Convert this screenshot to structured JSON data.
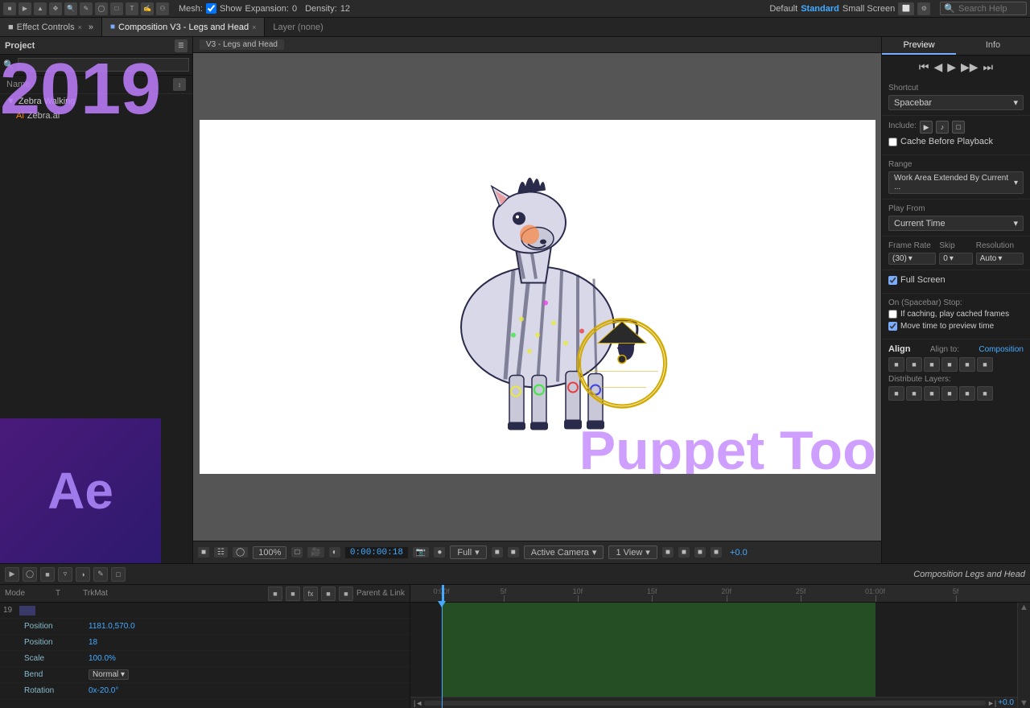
{
  "toolbar": {
    "mesh_label": "Mesh:",
    "show_label": "Show",
    "expansion_label": "Expansion:",
    "expansion_value": "0",
    "density_label": "Density:",
    "density_value": "12",
    "view_default": "Default",
    "view_standard": "Standard",
    "view_small": "Small Screen",
    "search_placeholder": "Search Help"
  },
  "tabs": {
    "effect_controls": "Effect Controls",
    "comp_tab": "Composition V3 - Legs and Head",
    "layer_none": "Layer (none)"
  },
  "breadcrumb": "V3 - Legs and Head",
  "project_panel": {
    "title": "Project",
    "search_placeholder": "",
    "items": [
      {
        "name": "Zebra Walking",
        "type": "folder"
      },
      {
        "name": "Zebra.ai",
        "type": "ai"
      }
    ]
  },
  "viewport": {
    "zoom": "100%",
    "timecode": "0:00:00:18",
    "quality": "Full",
    "camera": "Active Camera",
    "views": "1 View",
    "offset": "+0.0"
  },
  "right_panel": {
    "preview_tab": "Preview",
    "info_tab": "Info",
    "shortcut_label": "Shortcut",
    "shortcut_value": "Spacebar",
    "include_label": "Include:",
    "cache_label": "Cache Before Playback",
    "range_label": "Range",
    "range_value": "Work Area Extended By Current ...",
    "play_from_label": "Play From",
    "play_from_value": "Current Time",
    "frame_rate_label": "Frame Rate",
    "frame_rate_value": "(30)",
    "skip_label": "Skip",
    "skip_value": "0",
    "resolution_label": "Resolution",
    "resolution_value": "Auto",
    "full_screen_label": "Full Screen",
    "on_stop_label": "On (Spacebar) Stop:",
    "cached_frames_label": "If caching, play cached frames",
    "move_time_label": "Move time to preview time",
    "align_title": "Align",
    "align_to_label": "Align to:",
    "composition_label": "Composition",
    "distribute_label": "Distribute Layers:"
  },
  "timeline": {
    "comp_name": "Composition Legs and Head",
    "layer_headers": [
      "Mode",
      "T",
      "TrkMat",
      "Parent & Link"
    ],
    "layers": [
      {
        "number": "19",
        "name": "",
        "mode": "",
        "prop": "Position",
        "value": "1181.0,570.0"
      },
      {
        "number": "",
        "name": "Position",
        "mode": "",
        "value": "18"
      },
      {
        "number": "",
        "name": "Scale",
        "value": "100.0%"
      },
      {
        "number": "",
        "name": "Bend",
        "value": ""
      },
      {
        "number": "",
        "name": "Rotation",
        "value": "0x-20.0°"
      }
    ],
    "time_markers": [
      "0:00f",
      "5f",
      "10f",
      "15f",
      "20f",
      "25f",
      "01:00f",
      "5f"
    ],
    "playhead_pos": "0:00:00:18"
  },
  "year_overlay": "2019",
  "puppet_overlay": "Puppet Tool"
}
